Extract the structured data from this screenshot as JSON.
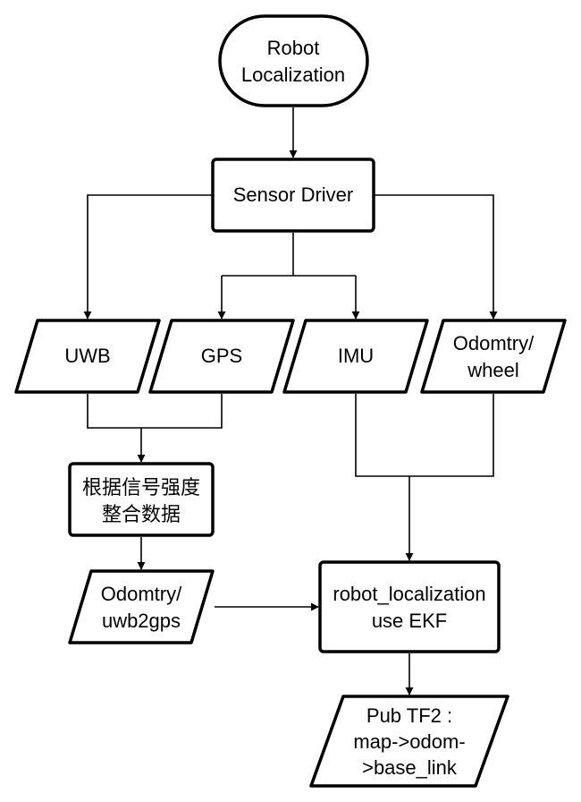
{
  "nodes": {
    "start": {
      "line1": "Robot",
      "line2": "Localization"
    },
    "sensor_driver": {
      "line1": "Sensor Driver"
    },
    "uwb": {
      "line1": "UWB"
    },
    "gps": {
      "line1": "GPS"
    },
    "imu": {
      "line1": "IMU"
    },
    "odom_wheel": {
      "line1": "Odomtry/",
      "line2": "wheel"
    },
    "merge": {
      "line1": "根据信号强度",
      "line2": "整合数据"
    },
    "odom_uwb": {
      "line1": "Odomtry/",
      "line2": "uwb2gps"
    },
    "ekf": {
      "line1": "robot_localization",
      "line2": "use EKF"
    },
    "tf2": {
      "line1": "Pub TF2 :",
      "line2": "map->odom-",
      "line3": ">base_link"
    }
  }
}
